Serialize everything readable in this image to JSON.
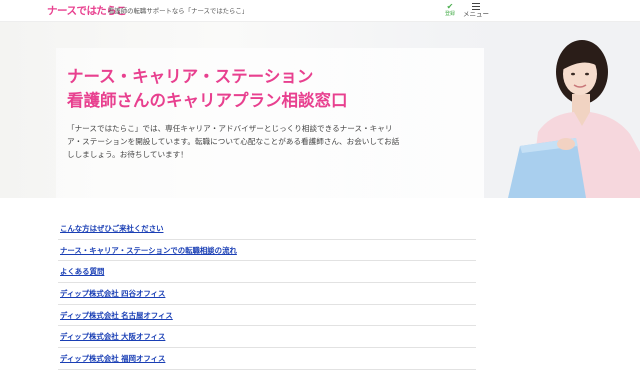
{
  "header": {
    "logo": "ナースではたらこ",
    "tagline": "看護師の転職サポートなら「ナースではたらこ」",
    "register_label": "登録",
    "menu_label": "メニュー"
  },
  "hero": {
    "title_line1": "ナース・キャリア・ステーション",
    "title_line2": "看護師さんのキャリアプラン相談窓口",
    "description": "「ナースではたらこ」では、専任キャリア・アドバイザーとじっくり相談できるナース・キャリア・ステーションを開設しています。転職について心配なことがある看護師さん、お会いしてお話ししましょう。お待ちしています！"
  },
  "links": [
    {
      "label": "こんな方はぜひご来社ください"
    },
    {
      "label": "ナース・キャリア・ステーションでの転職相談の流れ"
    },
    {
      "label": "よくある質問"
    },
    {
      "label": "ディップ株式会社 四谷オフィス"
    },
    {
      "label": "ディップ株式会社 名古屋オフィス"
    },
    {
      "label": "ディップ株式会社 大阪オフィス"
    },
    {
      "label": "ディップ株式会社 福岡オフィス"
    }
  ],
  "colors": {
    "brand_pink": "#e8408f",
    "link_blue": "#1a3fb5",
    "register_green": "#4caf50"
  },
  "icons": {
    "register": "check-icon",
    "menu": "hamburger-icon"
  }
}
